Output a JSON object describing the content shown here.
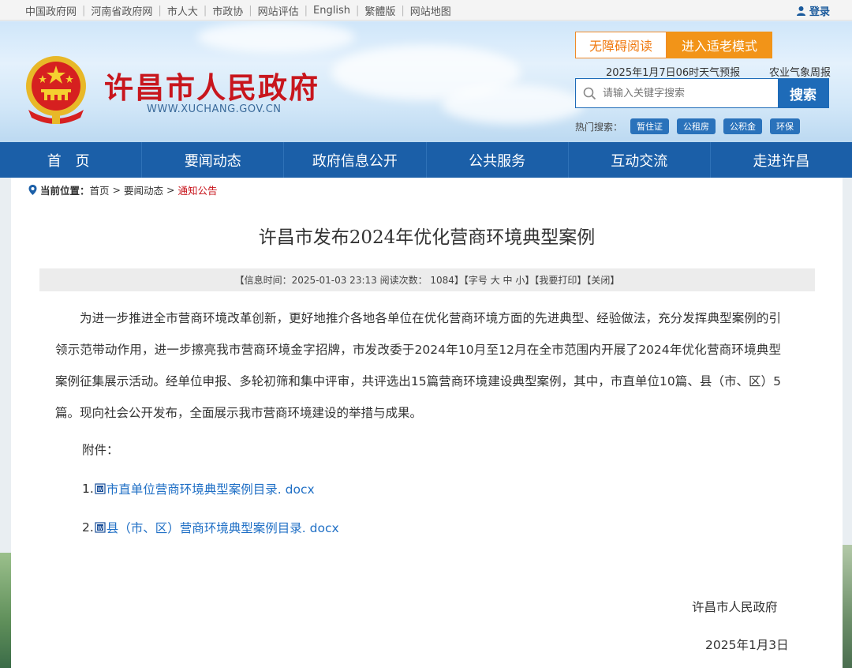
{
  "topbar": {
    "links": [
      "中国政府网",
      "河南省政府网",
      "市人大",
      "市政协",
      "网站评估",
      "English",
      "繁體版",
      "网站地图"
    ],
    "login": "登录"
  },
  "header": {
    "site_title": "许昌市人民政府",
    "site_url": "WWW.XUCHANG.GOV.CN",
    "accessible_btn": "无障碍阅读",
    "elder_btn": "进入适老模式",
    "weather": "2025年1月7日06时天气预报",
    "agri_weather": "农业气象周报",
    "search_placeholder": "请输入关键字搜索",
    "search_btn": "搜索",
    "hot_label": "热门搜索：",
    "hot_tags": [
      "暂住证",
      "公租房",
      "公积金",
      "环保"
    ]
  },
  "nav": [
    "首 页",
    "要闻动态",
    "政府信息公开",
    "公共服务",
    "互动交流",
    "走进许昌"
  ],
  "breadcrumb": {
    "label": "当前位置：",
    "items": [
      "首页",
      "要闻动态",
      "通知公告"
    ],
    "sep": ">"
  },
  "article": {
    "title": "许昌市发布2024年优化营商环境典型案例",
    "meta": "【信息时间：2025-01-03 23:13  阅读次数： 1084】【字号 大 中 小】【我要打印】【关闭】",
    "body": "为进一步推进全市营商环境改革创新，更好地推介各地各单位在优化营商环境方面的先进典型、经验做法，充分发挥典型案例的引领示范带动作用，进一步擦亮我市营商环境金字招牌，市发改委于2024年10月至12月在全市范围内开展了2024年优化营商环境典型案例征集展示活动。经单位申报、多轮初筛和集中评审，共评选出15篇营商环境建设典型案例，其中，市直单位10篇、县（市、区）5篇。现向社会公开发布，全面展示我市营商环境建设的举措与成果。",
    "attach_label": "附件：",
    "attachments": [
      {
        "num": "1.",
        "name": "市直单位营商环境典型案例目录. docx"
      },
      {
        "num": "2.",
        "name": "县（市、区）营商环境典型案例目录. docx"
      }
    ],
    "signature": "许昌市人民政府",
    "date": "2025年1月3日"
  },
  "colors": {
    "nav": "#1b5fa8",
    "title_red": "#c8161d",
    "accent_orange": "#f29418",
    "link": "#1f6fc5"
  }
}
